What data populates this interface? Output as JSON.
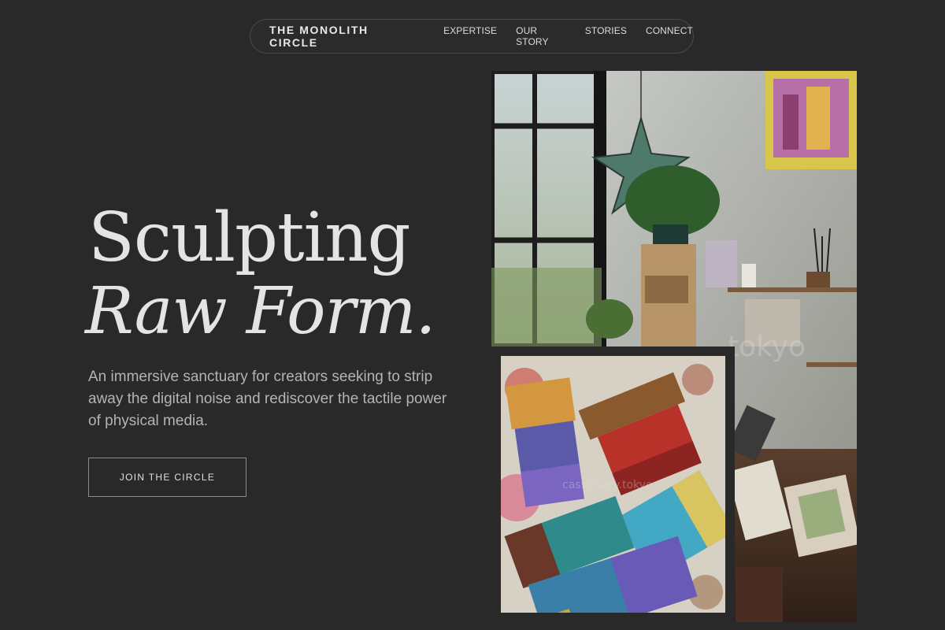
{
  "nav": {
    "brand": "THE MONOLITH CIRCLE",
    "links": [
      "EXPERTISE",
      "OUR STORY",
      "STORIES",
      "CONNECT"
    ]
  },
  "hero": {
    "headline_line1": "Sculpting",
    "headline_line2": "Raw Form.",
    "description": "An immersive sanctuary for creators seeking to strip away the digital noise and rediscover the tactile power of physical media.",
    "cta_label": "JOIN THE CIRCLE"
  },
  "images": {
    "studio_watermark": "tokyo",
    "brushes_watermark": "cassowary.tokyo"
  },
  "colors": {
    "background": "#292929",
    "text_primary": "#e4e4e4",
    "text_secondary": "#b4b4b4",
    "border": "#4a4a4a"
  }
}
